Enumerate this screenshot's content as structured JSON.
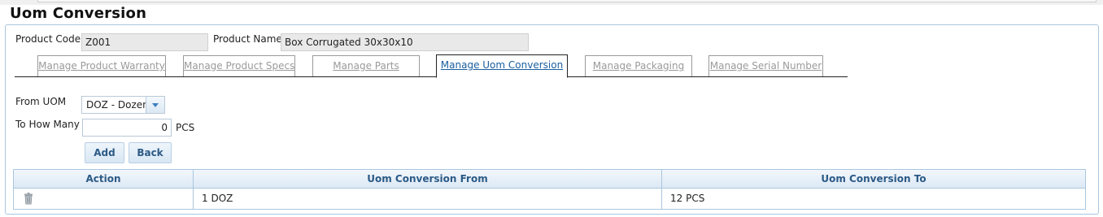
{
  "page": {
    "title": "Uom Conversion"
  },
  "product": {
    "code_label": "Product Code",
    "code_value": "Z001",
    "name_label": "Product Name",
    "name_value": "Box Corrugated 30x30x10"
  },
  "tabs": [
    {
      "label": "Manage Product Warranty",
      "active": false
    },
    {
      "label": "Manage Product Specs",
      "active": false
    },
    {
      "label": "Manage Parts",
      "active": false
    },
    {
      "label": "Manage Uom Conversion",
      "active": true
    },
    {
      "label": "Manage Packaging",
      "active": false
    },
    {
      "label": "Manage Serial Number",
      "active": false
    }
  ],
  "form": {
    "from_uom_label": "From UOM",
    "from_uom_value": "DOZ - Dozen",
    "to_how_many_label": "To How Many",
    "to_how_many_value": "0",
    "to_unit": "PCS",
    "add_label": "Add",
    "back_label": "Back"
  },
  "table": {
    "columns": [
      "Action",
      "Uom Conversion From",
      "Uom Conversion To"
    ],
    "rows": [
      {
        "action_icon": "trash-icon",
        "from": "1 DOZ",
        "to": "12 PCS"
      }
    ]
  },
  "colors": {
    "header_text": "#2c5a86",
    "active_tab": "#1a5fa0",
    "border": "#a9c6de"
  }
}
